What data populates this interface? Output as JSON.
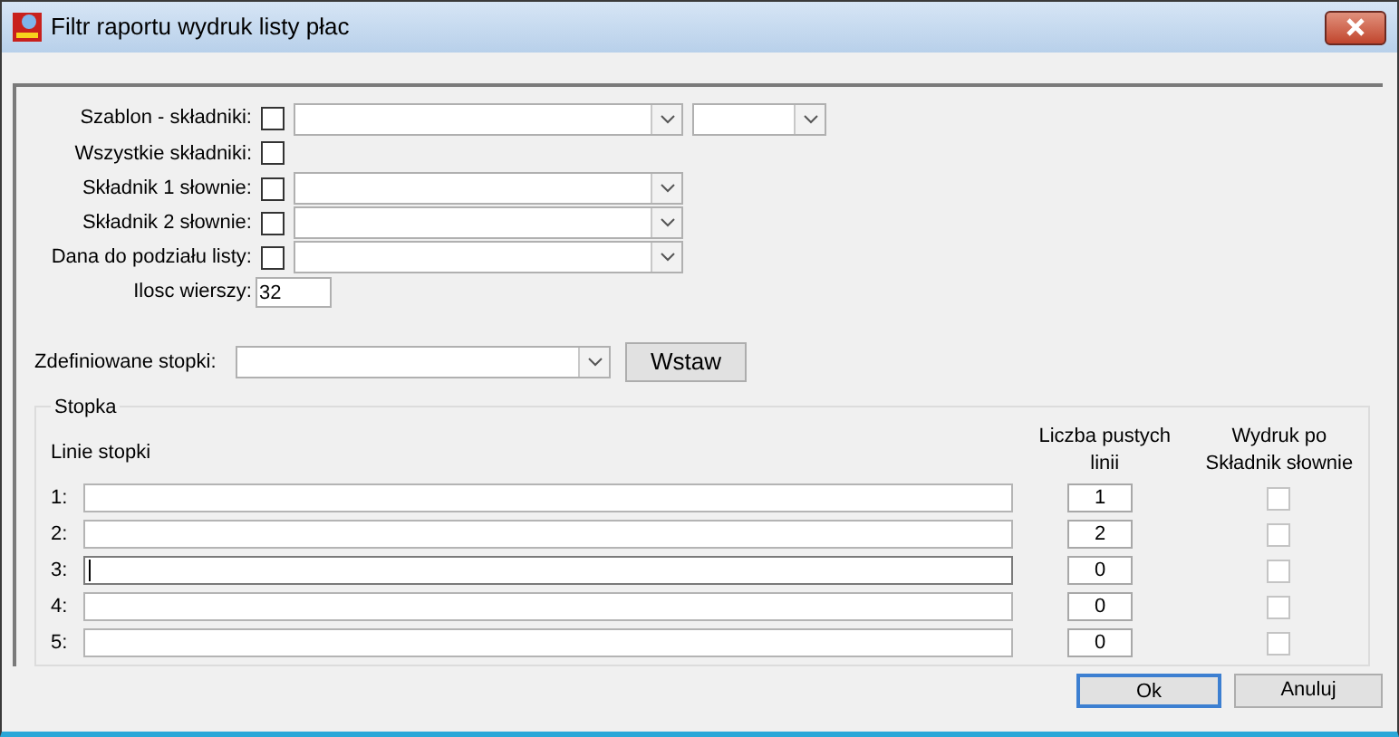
{
  "window": {
    "title": "Filtr raportu wydruk listy płac"
  },
  "filters": [
    {
      "kind": "checkbox_double_combo",
      "label": "Szablon - składniki:",
      "checked": false
    },
    {
      "kind": "checkbox",
      "label": "Wszystkie składniki:",
      "checked": false
    },
    {
      "kind": "checkbox_combo",
      "label": "Składnik 1 słownie:",
      "checked": false
    },
    {
      "kind": "checkbox_combo",
      "label": "Składnik 2 słownie:",
      "checked": false
    },
    {
      "kind": "checkbox_combo",
      "label": "Dana do podziału listy:",
      "checked": false
    },
    {
      "kind": "input",
      "label": "Ilosc wierszy:",
      "value": "32"
    }
  ],
  "footer_preset": {
    "label": "Zdefiniowane stopki:",
    "button": "Wstaw"
  },
  "stopka": {
    "title": "Stopka",
    "columns": [
      "Linie stopki",
      "Liczba pustych linii",
      "Wydruk po Składnik słownie"
    ],
    "rows": [
      {
        "number": "1:",
        "blank_lines": "1",
        "focused": false,
        "checked": false,
        "disabled": true
      },
      {
        "number": "2:",
        "blank_lines": "2",
        "focused": false,
        "checked": false,
        "disabled": true
      },
      {
        "number": "3:",
        "blank_lines": "0",
        "focused": true,
        "checked": false,
        "disabled": true
      },
      {
        "number": "4:",
        "blank_lines": "0",
        "focused": false,
        "checked": false,
        "disabled": true
      },
      {
        "number": "5:",
        "blank_lines": "0",
        "focused": false,
        "checked": false,
        "disabled": true
      }
    ]
  },
  "buttons": [
    {
      "label": "Ok",
      "default": true
    },
    {
      "label": "Anuluj",
      "default": false
    }
  ]
}
